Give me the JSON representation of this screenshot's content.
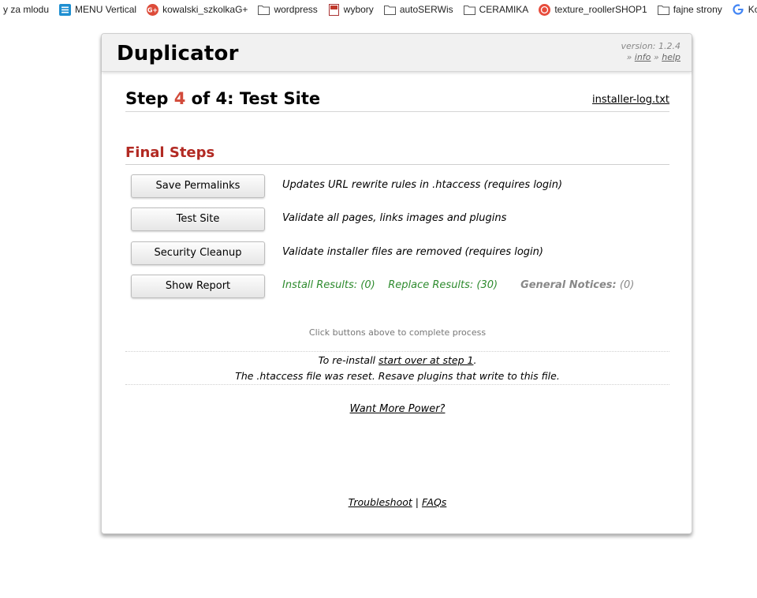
{
  "bookmarks": [
    {
      "label": "y za mlodu",
      "icon": "none"
    },
    {
      "label": "MENU Vertical",
      "icon": "list-icon"
    },
    {
      "label": "kowalski_szkolkaG+",
      "icon": "google-plus-icon"
    },
    {
      "label": "wordpress",
      "icon": "folder-icon"
    },
    {
      "label": "wybory",
      "icon": "document-icon"
    },
    {
      "label": "autoSERWis",
      "icon": "folder-icon"
    },
    {
      "label": "CERAMIKA",
      "icon": "folder-icon"
    },
    {
      "label": "texture_roollerSHOP1",
      "icon": "site-logo-icon"
    },
    {
      "label": "fajne strony",
      "icon": "folder-icon"
    },
    {
      "label": "Konsola A",
      "icon": "google-icon"
    }
  ],
  "header": {
    "title": "Duplicator",
    "version": "version: 1.2.4",
    "sep": "»",
    "info_label": "info",
    "help_label": "help"
  },
  "step": {
    "prefix": "Step ",
    "number": "4",
    "suffix": " of 4: Test Site",
    "log_link": "installer-log.txt"
  },
  "final_steps": {
    "title": "Final Steps",
    "items": [
      {
        "button": "Save Permalinks",
        "description": "Updates URL rewrite rules in .htaccess (requires login)"
      },
      {
        "button": "Test Site",
        "description": "Validate all pages, links images and plugins"
      },
      {
        "button": "Security Cleanup",
        "description": "Validate installer files are removed (requires login)"
      },
      {
        "button": "Show Report",
        "description": ""
      }
    ],
    "report": {
      "install_results": "Install Results: (0)",
      "replace_results": "Replace Results: (30)",
      "notices_label": "General Notices:",
      "notices_value": "(0)"
    }
  },
  "hint": "Click buttons above to complete process",
  "notes": {
    "reinstall_prefix": "To re-install ",
    "reinstall_link": "start over at step 1",
    "reinstall_suffix": ".",
    "htaccess": "The .htaccess file was reset. Resave plugins that write to this file."
  },
  "power_link": "Want More Power?",
  "footer": {
    "troubleshoot": "Troubleshoot",
    "sep": "|",
    "faqs": "FAQs"
  },
  "colors": {
    "accent_red": "#b22a23",
    "step_number": "#d24a3a",
    "results_green": "#2e8b2e",
    "muted_gray": "#888888"
  }
}
